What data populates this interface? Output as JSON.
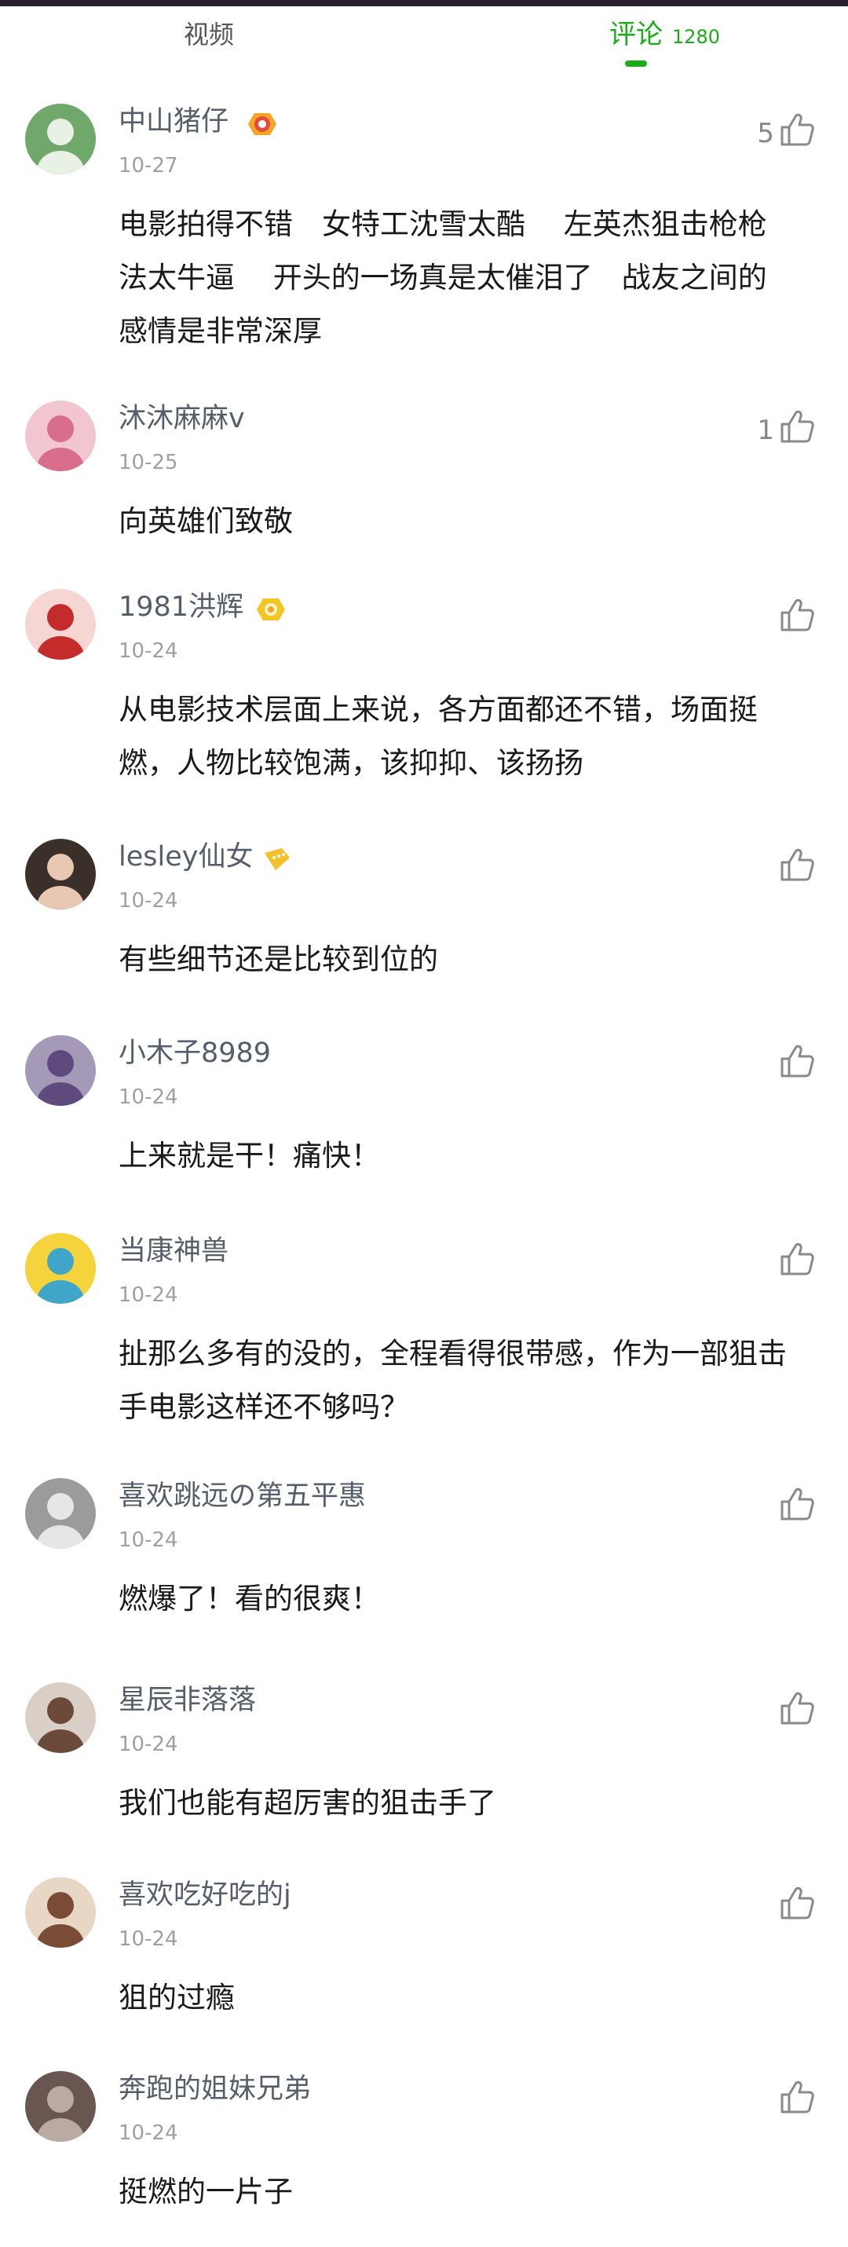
{
  "tabs": {
    "video_label": "视频",
    "comments_label": "评论",
    "comments_count": "1280",
    "accent_color": "#1aad19"
  },
  "comments": [
    {
      "user": "中山猪仔",
      "date": "10-27",
      "likes": "5",
      "badge": "red-target-badge-icon",
      "text": "电影拍得不错　女特工沈雪太酷　 左英杰狙击枪枪\n法太牛逼　 开头的一场真是太催泪了　战友之间的\n感情是非常深厚"
    },
    {
      "user": "沐沐麻麻v",
      "date": "10-25",
      "likes": "1",
      "badge": "",
      "text": "向英雄们致敬"
    },
    {
      "user": "1981洪辉",
      "date": "10-24",
      "likes": "",
      "badge": "yellow-ring-badge-icon",
      "text": "从电影技术层面上来说，各方面都还不错，场面挺\n燃，人物比较饱满，该抑抑、该扬扬"
    },
    {
      "user": "lesley仙女",
      "date": "10-24",
      "likes": "",
      "badge": "yellow-flag-badge-icon",
      "text": "有些细节还是比较到位的"
    },
    {
      "user": "小木子8989",
      "date": "10-24",
      "likes": "",
      "badge": "",
      "text": "上来就是干！痛快！"
    },
    {
      "user": "当康神兽",
      "date": "10-24",
      "likes": "",
      "badge": "",
      "text": "扯那么多有的没的，全程看得很带感，作为一部狙击\n手电影这样还不够吗？"
    },
    {
      "user": "喜欢跳远の第五平惠",
      "date": "10-24",
      "likes": "",
      "badge": "",
      "text": "燃爆了！看的很爽！"
    },
    {
      "user": "星辰非落落",
      "date": "10-24",
      "likes": "",
      "badge": "",
      "text": "我们也能有超厉害的狙击手了"
    },
    {
      "user": "喜欢吃好吃的j",
      "date": "10-24",
      "likes": "",
      "badge": "",
      "text": "狙的过瘾"
    },
    {
      "user": "奔跑的姐妹兄弟",
      "date": "10-24",
      "likes": "",
      "badge": "",
      "text": "挺燃的一片子"
    }
  ],
  "avatars": [
    {
      "icon": "avatar-green-woman",
      "bg": "#6fa86a",
      "fg": "#e9f1e4"
    },
    {
      "icon": "avatar-flower-girl",
      "bg": "#f2c6cf",
      "fg": "#d86d8c"
    },
    {
      "icon": "avatar-red-flower-girl",
      "bg": "#f5d6d3",
      "fg": "#c42c2c"
    },
    {
      "icon": "avatar-dark-hair-woman",
      "bg": "#3b2f2a",
      "fg": "#e8c8b3"
    },
    {
      "icon": "avatar-lilac-flowers",
      "bg": "#a49ab8",
      "fg": "#5e4a7c"
    },
    {
      "icon": "avatar-yellow-cartoon",
      "bg": "#f4d33c",
      "fg": "#3fa6c9"
    },
    {
      "icon": "avatar-grey-hands",
      "bg": "#9b9b9b",
      "fg": "#e6e6e6"
    },
    {
      "icon": "avatar-girl-portrait",
      "bg": "#d9cfc6",
      "fg": "#6b4a3a"
    },
    {
      "icon": "avatar-smiling-girl",
      "bg": "#e9d7c5",
      "fg": "#7a4b36"
    },
    {
      "icon": "avatar-mercedes-cap",
      "bg": "#6a5650",
      "fg": "#b9aba4"
    }
  ]
}
